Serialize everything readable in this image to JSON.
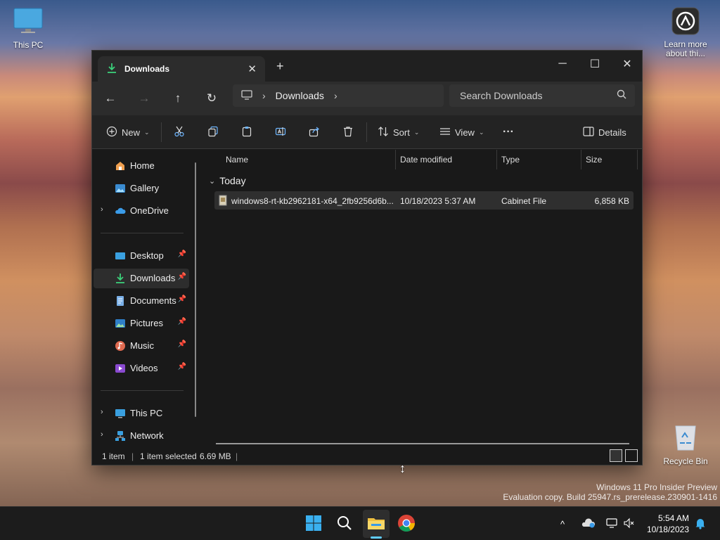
{
  "desktop": {
    "this_pc_label": "This PC",
    "learn_more_label": "Learn more about thi...",
    "recycle_bin_label": "Recycle Bin"
  },
  "window": {
    "tab_title": "Downloads",
    "new_tab_symbol": "+",
    "address": {
      "root_icon": "monitor-icon",
      "crumb": "Downloads"
    },
    "search_placeholder": "Search Downloads",
    "toolbar": {
      "new_label": "New",
      "sort_label": "Sort",
      "view_label": "View",
      "more_label": "···",
      "details_label": "Details"
    },
    "sidebar": {
      "items": [
        {
          "label": "Home",
          "icon": "home-icon"
        },
        {
          "label": "Gallery",
          "icon": "gallery-icon"
        },
        {
          "label": "OneDrive",
          "icon": "cloud-icon"
        },
        {
          "label": "Desktop",
          "icon": "desktop-icon"
        },
        {
          "label": "Downloads",
          "icon": "download-icon"
        },
        {
          "label": "Documents",
          "icon": "document-icon"
        },
        {
          "label": "Pictures",
          "icon": "picture-icon"
        },
        {
          "label": "Music",
          "icon": "music-icon"
        },
        {
          "label": "Videos",
          "icon": "video-icon"
        },
        {
          "label": "This PC",
          "icon": "monitor-icon"
        },
        {
          "label": "Network",
          "icon": "network-icon"
        }
      ]
    },
    "columns": [
      "Name",
      "Date modified",
      "Type",
      "Size"
    ],
    "group_label": "Today",
    "files": [
      {
        "name": "windows8-rt-kb2962181-x64_2fb9256d6b...",
        "date": "10/18/2023 5:37 AM",
        "type": "Cabinet File",
        "size": "6,858 KB"
      }
    ],
    "status": {
      "count": "1 item",
      "selected": "1 item selected",
      "size": "6.69 MB"
    }
  },
  "watermark": {
    "line1": "Windows 11 Pro Insider Preview",
    "line2": "Evaluation copy. Build 25947.rs_prerelease.230901-1416"
  },
  "taskbar": {
    "time": "5:54 AM",
    "date": "10/18/2023"
  },
  "colors": {
    "accent": "#60cdff",
    "download_green": "#3bd07a",
    "window_bg": "#191919"
  }
}
